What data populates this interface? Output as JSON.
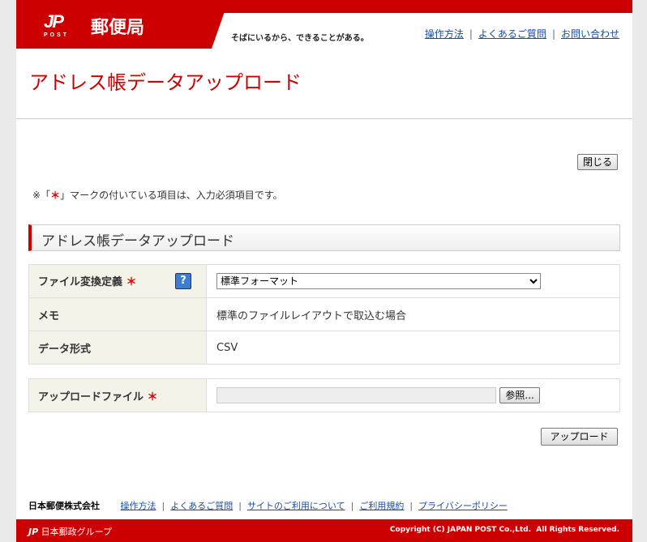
{
  "header": {
    "logo_mark": "JP",
    "logo_sub": "POST",
    "brand": "郵便局",
    "tagline": "そばにいるから、できることがある。",
    "links": [
      "操作方法",
      "よくあるご質問",
      "お問い合わせ"
    ]
  },
  "page_title": "アドレス帳データアップロード",
  "close_label": "閉じる",
  "note_prefix": "※「",
  "note_mark": "＊",
  "note_suffix": "」マークの付いている項目は、入力必須項目です。",
  "section_title": "アドレス帳データアップロード",
  "form": {
    "conv_label": "ファイル変換定義",
    "required_mark": "＊",
    "help": "?",
    "conv_value": "標準フォーマット",
    "memo_label": "メモ",
    "memo_value": "標準のファイルレイアウトで取込む場合",
    "format_label": "データ形式",
    "format_value": "CSV",
    "upload_label": "アップロードファイル",
    "file_value": "",
    "browse_label": "参照...",
    "upload_button": "アップロード"
  },
  "footer": {
    "company": "日本郵便株式会社",
    "links": [
      "操作方法",
      "よくあるご質問",
      "サイトのご利用について",
      "ご利用規約",
      "プライバシーポリシー"
    ],
    "group": "日本郵政グループ",
    "copyright": "Copyright (C) JAPAN POST Co.,Ltd.  All Rights Reserved."
  }
}
